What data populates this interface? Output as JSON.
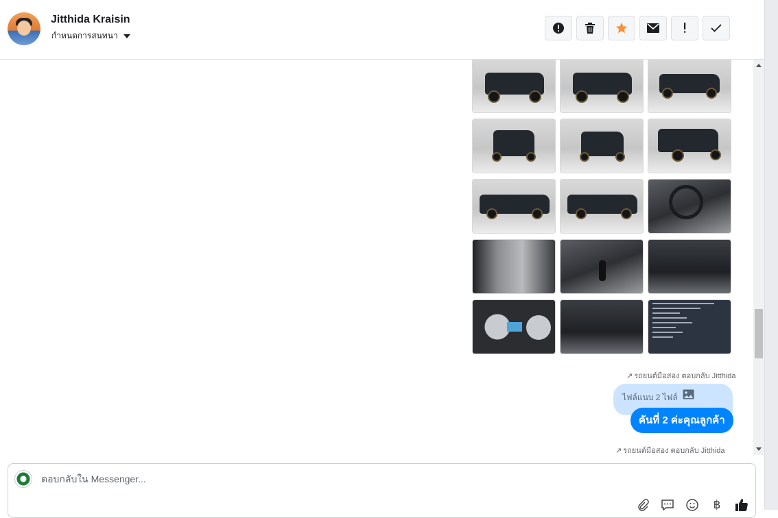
{
  "header": {
    "name": "Jitthida Kraisin",
    "assign_label": "กำหนดการสนทนา",
    "actions": [
      {
        "name": "alert-circle-icon",
        "label": "Mark as spam"
      },
      {
        "name": "trash-icon",
        "label": "Delete"
      },
      {
        "name": "star-icon",
        "label": "Star",
        "color": "#f7923a"
      },
      {
        "name": "envelope-icon",
        "label": "Mark unread"
      },
      {
        "name": "exclamation-icon",
        "label": "Follow up"
      },
      {
        "name": "check-icon",
        "label": "Done"
      }
    ]
  },
  "conversation": {
    "photos": [
      "truck-front-left",
      "truck-front-left",
      "truck-rear-left",
      "truck-front",
      "truck-rear",
      "truck-rear-right",
      "truck-side-left",
      "truck-side-left",
      "steering-wheel",
      "door-panel",
      "gear-shifter",
      "front-seats",
      "instrument-cluster",
      "rear-seats",
      "document"
    ],
    "meta_1": "รถยนต์มือสอง ตอบกลับ Jitthida",
    "attachment_label": "ไฟล์แนบ 2 ไฟล์",
    "message": "คันที่ 2 ค่ะคุณลูกค้า",
    "meta_2": "รถยนต์มือสอง ตอบกลับ Jitthida"
  },
  "composer": {
    "placeholder": "ตอบกลับใน Messenger...",
    "tools": [
      "paperclip-icon",
      "saved-reply-icon",
      "emoji-icon",
      "baht-icon",
      "thumbs-up-icon"
    ],
    "like_color": "#1c1e21"
  },
  "colors": {
    "outgoing_bubble": "#0084ff",
    "attachment_bubble": "#cce4ff",
    "accent": "#f7923a"
  }
}
